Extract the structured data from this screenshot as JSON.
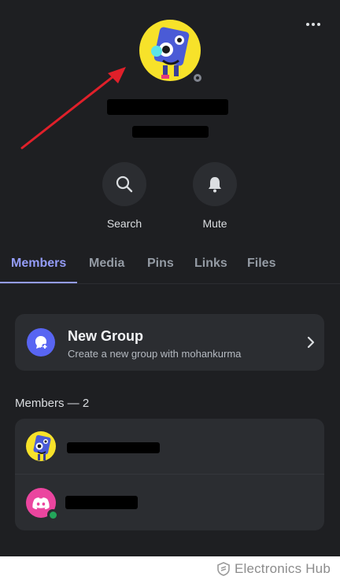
{
  "header": {
    "more_icon": "more-horizontal-icon",
    "profile_name": "",
    "profile_username": ""
  },
  "actions": [
    {
      "label": "Search",
      "icon": "search-icon"
    },
    {
      "label": "Mute",
      "icon": "bell-icon"
    }
  ],
  "tabs": [
    {
      "label": "Members",
      "active": true
    },
    {
      "label": "Media",
      "active": false
    },
    {
      "label": "Pins",
      "active": false
    },
    {
      "label": "Links",
      "active": false
    },
    {
      "label": "Files",
      "active": false
    }
  ],
  "new_group": {
    "title": "New Group",
    "subtitle": "Create a new group with mohankurma",
    "icon": "new-group-icon"
  },
  "members_section": {
    "title": "Members — 2",
    "members": [
      {
        "name": "",
        "avatar": "robot-avatar",
        "status": ""
      },
      {
        "name": "",
        "avatar": "discord-logo-avatar",
        "status": "online"
      }
    ]
  },
  "watermark": {
    "text": "Electronics Hub"
  },
  "colors": {
    "background": "#1e1f22",
    "card": "#2b2d31",
    "accent": "#949cf7",
    "blurple": "#5865f2",
    "online": "#23a55a",
    "annotation_arrow": "#e0202a"
  }
}
